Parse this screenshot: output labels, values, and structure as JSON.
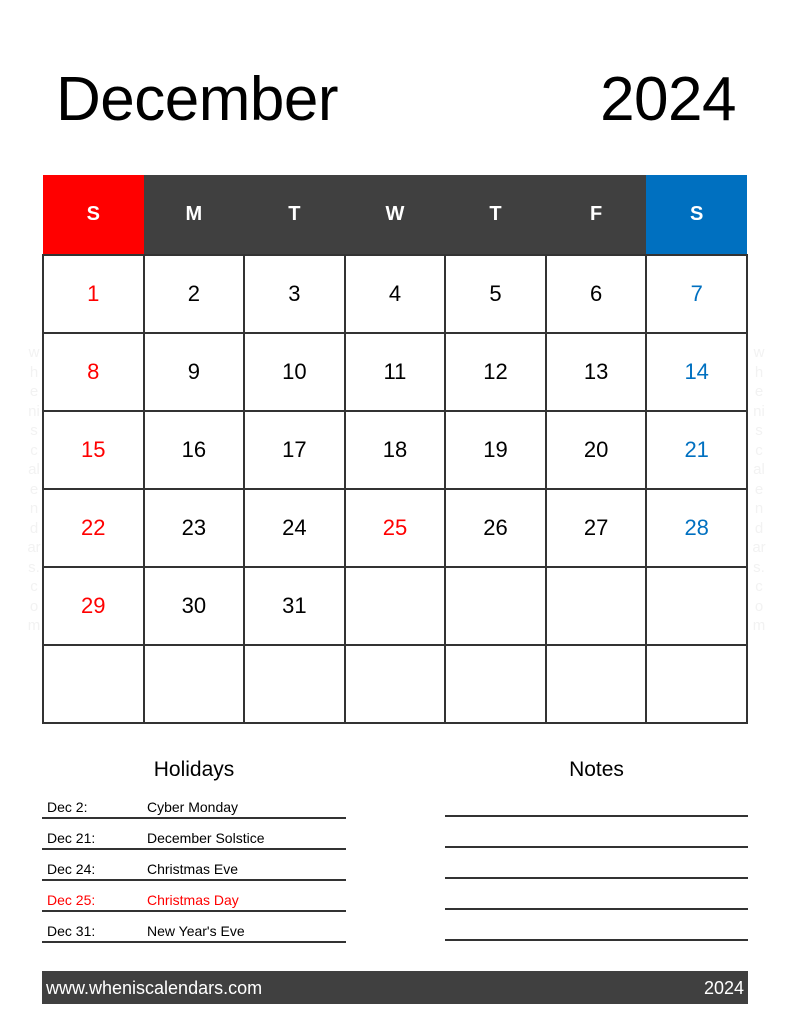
{
  "header": {
    "month": "December",
    "year": "2024"
  },
  "watermark": [
    "w",
    "h",
    "e",
    "ni",
    "s",
    "c",
    "al",
    "e",
    "n",
    "d",
    "ar",
    "s.",
    "c",
    "o",
    "m"
  ],
  "calendar": {
    "weekdays": [
      "S",
      "M",
      "T",
      "W",
      "T",
      "F",
      "S"
    ],
    "colors": {
      "sunday": "#ff0000",
      "saturday": "#0070c0",
      "weekday_header": "#404040",
      "holiday": "#ff0000"
    },
    "weeks": [
      [
        "1",
        "2",
        "3",
        "4",
        "5",
        "6",
        "7"
      ],
      [
        "8",
        "9",
        "10",
        "11",
        "12",
        "13",
        "14"
      ],
      [
        "15",
        "16",
        "17",
        "18",
        "19",
        "20",
        "21"
      ],
      [
        "22",
        "23",
        "24",
        "25",
        "26",
        "27",
        "28"
      ],
      [
        "29",
        "30",
        "31",
        "",
        "",
        "",
        ""
      ],
      [
        "",
        "",
        "",
        "",
        "",
        "",
        ""
      ]
    ],
    "highlighted_holidays": [
      "25"
    ]
  },
  "holidays": {
    "title": "Holidays",
    "items": [
      {
        "date": "Dec 2:",
        "name": "Cyber Monday",
        "highlight": false
      },
      {
        "date": "Dec 21:",
        "name": "December Solstice",
        "highlight": false
      },
      {
        "date": "Dec 24:",
        "name": "Christmas Eve",
        "highlight": false
      },
      {
        "date": "Dec 25:",
        "name": "Christmas Day",
        "highlight": true
      },
      {
        "date": "Dec 31:",
        "name": "New Year's Eve",
        "highlight": false
      }
    ]
  },
  "notes": {
    "title": "Notes",
    "line_count": 5
  },
  "footer": {
    "url": "www.wheniscalendars.com",
    "year": "2024"
  }
}
